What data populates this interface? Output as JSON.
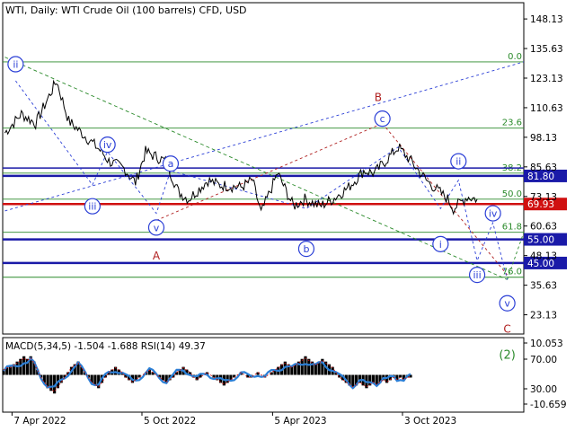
{
  "header": {
    "symbol_line": "WTI, Daily:  WTI Crude Oil (100 barrels) CFD, USD"
  },
  "indicator": {
    "label": "MACD(5,34,5) -1.504 -1.688 RSI(14) 49.37"
  },
  "colors": {
    "price": "#000000",
    "fib": "#2a8a2a",
    "level_blue": "#1a1aa8",
    "level_red": "#d01010",
    "wave_blue": "#2b3fd6",
    "wave_red": "#b02020",
    "wave_green": "#2a8a2a",
    "rsi": "#2c7fd6"
  },
  "chart_data": [
    {
      "type": "line",
      "title": "WTI, Daily:  WTI Crude Oil (100 barrels) CFD, USD",
      "ylim": [
        15.0,
        155.0
      ],
      "yticks": [
        "148.13",
        "135.63",
        "123.13",
        "110.63",
        "98.13",
        "85.63",
        "73.13",
        "60.63",
        "48.13",
        "35.63",
        "23.13"
      ],
      "xticks": [
        "7 Apr 2022",
        "5 Oct 2022",
        "5 Apr 2023",
        "3 Oct 2023"
      ],
      "series": [
        {
          "name": "",
          "x": [
            "2022-03-28",
            "2022-04-20",
            "2022-05-10",
            "2022-06-08",
            "2022-06-25",
            "2022-07-20",
            "2022-08-10",
            "2022-08-20",
            "2022-09-10",
            "2022-09-26",
            "2022-10-10",
            "2022-11-07",
            "2022-11-25",
            "2022-12-09",
            "2023-01-05",
            "2023-01-20",
            "2023-02-20",
            "2023-03-08",
            "2023-03-20",
            "2023-04-12",
            "2023-05-04",
            "2023-05-20",
            "2023-06-10",
            "2023-06-28",
            "2023-07-20",
            "2023-08-10",
            "2023-08-25",
            "2023-09-27",
            "2023-10-15",
            "2023-11-05",
            "2023-11-20",
            "2023-12-05",
            "2023-12-13",
            "2024-01-01",
            "2024-01-15"
          ],
          "values": [
            100,
            108,
            104,
            122,
            105,
            98,
            92,
            88,
            85,
            79,
            92,
            88,
            75,
            72,
            80,
            78,
            77,
            80,
            66,
            83,
            69,
            72,
            69,
            72,
            77,
            84,
            83,
            94,
            88,
            80,
            76,
            72,
            68,
            73,
            72
          ]
        }
      ],
      "levels": [
        {
          "price": 81.8,
          "label": "81.80",
          "color": "blue"
        },
        {
          "price": 69.93,
          "label": "69.93",
          "color": "red"
        },
        {
          "price": 55.0,
          "label": "55.00",
          "color": "blue"
        },
        {
          "price": 45.0,
          "label": "45.00",
          "color": "blue"
        }
      ],
      "fibonacci": [
        {
          "ratio": "0.0",
          "price": 130
        },
        {
          "ratio": "23.6",
          "price": 102
        },
        {
          "ratio": "38.2",
          "price": 83
        },
        {
          "ratio": "50.0",
          "price": 72
        },
        {
          "ratio": "61.8",
          "price": 58
        },
        {
          "ratio": "76.0",
          "price": 39
        }
      ],
      "wave_labels": [
        {
          "text": "ii",
          "style": "circle",
          "color": "blue",
          "x": "2022-04-12",
          "price": 129
        },
        {
          "text": "iv",
          "style": "circle",
          "color": "blue",
          "x": "2022-08-18",
          "price": 95
        },
        {
          "text": "iii",
          "style": "circle",
          "color": "blue",
          "x": "2022-07-28",
          "price": 69
        },
        {
          "text": "a",
          "style": "circle",
          "color": "blue",
          "x": "2022-11-14",
          "price": 87
        },
        {
          "text": "v",
          "style": "circle",
          "color": "blue",
          "x": "2022-10-25",
          "price": 60
        },
        {
          "text": "A",
          "style": "letter",
          "color": "red",
          "x": "2022-10-25",
          "price": 48
        },
        {
          "text": "b",
          "style": "circle",
          "color": "blue",
          "x": "2023-05-22",
          "price": 51
        },
        {
          "text": "B",
          "style": "letter",
          "color": "red",
          "x": "2023-08-30",
          "price": 115
        },
        {
          "text": "c",
          "style": "circle",
          "color": "blue",
          "x": "2023-09-05",
          "price": 106
        },
        {
          "text": "ii",
          "style": "circle",
          "color": "blue",
          "x": "2023-12-20",
          "price": 88
        },
        {
          "text": "i",
          "style": "circle",
          "color": "blue",
          "x": "2023-11-25",
          "price": 53
        },
        {
          "text": "iv",
          "style": "circle",
          "color": "blue",
          "x": "2024-02-06",
          "price": 66
        },
        {
          "text": "iii",
          "style": "circle",
          "color": "blue",
          "x": "2024-01-15",
          "price": 40
        },
        {
          "text": "v",
          "style": "circle",
          "color": "blue",
          "x": "2024-02-26",
          "price": 28
        },
        {
          "text": "C",
          "style": "letter",
          "color": "red",
          "x": "2024-02-26",
          "price": 17
        },
        {
          "text": "(2)",
          "style": "letter",
          "color": "green",
          "x": "2024-02-26",
          "price": 6
        }
      ]
    },
    {
      "type": "line",
      "title": "MACD(5,34,5) -1.504 -1.688 RSI(14) 49.37",
      "ylim": [
        -14,
        14
      ],
      "yticks": [
        "10.053",
        "70.00",
        "30.00",
        "-10.659"
      ],
      "series": [
        {
          "name": "",
          "x": [
            0,
            1,
            2,
            3,
            4,
            5,
            6,
            7,
            8,
            9,
            10,
            11,
            12,
            13,
            14,
            15,
            16,
            17,
            18,
            19,
            20,
            21,
            22,
            23,
            24,
            25,
            26,
            27,
            28,
            29,
            30,
            31,
            32,
            33,
            34,
            35,
            36,
            37,
            38,
            39,
            40,
            41,
            42,
            43,
            44,
            45,
            46,
            47,
            48,
            49,
            50,
            51,
            52,
            53,
            54,
            55,
            56,
            57,
            58,
            59,
            60,
            61,
            62,
            63,
            64,
            65,
            66,
            67,
            68,
            69,
            70,
            71,
            72,
            73,
            74,
            75,
            76,
            77,
            78,
            79,
            80,
            81,
            82,
            83,
            84,
            85,
            86,
            87,
            88,
            89,
            90,
            91,
            92,
            93,
            94,
            95,
            96,
            97,
            98,
            99,
            100,
            101,
            102,
            103,
            104,
            105,
            106,
            107,
            108,
            109,
            110,
            111,
            112,
            113,
            114,
            115,
            116,
            117,
            118,
            119,
            120
          ],
          "values": [
            2,
            3,
            3,
            4,
            5,
            6,
            7,
            6,
            7,
            5,
            2,
            -1,
            -3,
            -5,
            -6,
            -7,
            -5,
            -3,
            -1,
            1,
            3,
            4,
            5,
            3,
            1,
            -1,
            -3,
            -4,
            -5,
            -3,
            -1,
            1,
            2,
            3,
            2,
            1,
            -1,
            -2,
            -3,
            -2,
            -1,
            0,
            1,
            2,
            1,
            0,
            -1,
            -2,
            -3,
            -2,
            -1,
            1,
            2,
            3,
            2,
            1,
            -1,
            -2,
            -1,
            0,
            1,
            0,
            -1,
            -2,
            -3,
            -4,
            -3,
            -2,
            -1,
            0,
            1,
            0,
            -1,
            -1,
            0,
            1,
            0,
            -1,
            0,
            1,
            2,
            3,
            4,
            5,
            4,
            3,
            4,
            5,
            6,
            7,
            6,
            5,
            4,
            5,
            6,
            5,
            4,
            3,
            1,
            -1,
            -2,
            -3,
            -4,
            -5,
            -4,
            -3,
            -4,
            -5,
            -4,
            -3,
            -4,
            -3,
            -2,
            -3,
            -2,
            -1,
            -2,
            -1,
            -2,
            -1,
            -1
          ]
        }
      ]
    }
  ]
}
